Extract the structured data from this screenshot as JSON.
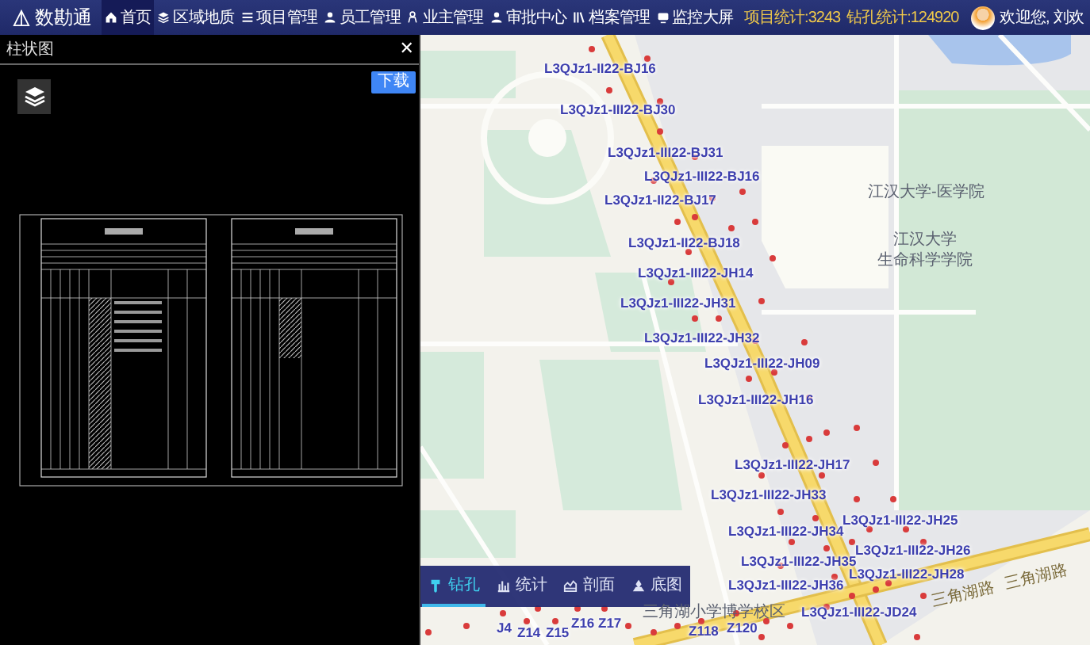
{
  "nav": {
    "logo": "数勘通",
    "items": [
      {
        "label": "首页",
        "kind": "home",
        "selected": true
      },
      {
        "label": "区域地质",
        "kind": "layers",
        "selected": false
      },
      {
        "label": "项目管理",
        "kind": "list",
        "selected": false
      },
      {
        "label": "员工管理",
        "kind": "person",
        "selected": false
      },
      {
        "label": "业主管理",
        "kind": "owner",
        "selected": false
      },
      {
        "label": "审批中心",
        "kind": "person",
        "selected": false
      },
      {
        "label": "档案管理",
        "kind": "books",
        "selected": false
      },
      {
        "label": "监控大屏",
        "kind": "monitor",
        "selected": false
      }
    ],
    "stats": [
      "项目统计:3243",
      "钻孔统计:124920"
    ],
    "greeting": "欢迎您, 刘欢"
  },
  "panel": {
    "title": "柱状图",
    "close": "✕",
    "download": "下载"
  },
  "map": {
    "boreholes": [
      "L3QJz1-II22-BJ16",
      "L3QJz1-III22-BJ30",
      "L3QJz1-III22-BJ31",
      "L3QJz1-III22-BJ16",
      "L3QJz1-II22-BJ17",
      "L3QJz1-II22-BJ18",
      "L3QJz1-III22-JH14",
      "L3QJz1-III22-JH31",
      "L3QJz1-III22-JH32",
      "L3QJz1-III22-JH09",
      "L3QJz1-III22-JH16",
      "L3QJz1-III22-JH17",
      "L3QJz1-III22-JH33",
      "L3QJz1-III22-JH34",
      "L3QJz1-III22-JH25",
      "L3QJz1-III22-JH26",
      "L3QJz1-III22-JH35",
      "L3QJz1-III22-JH28",
      "L3QJz1-III22-JH36",
      "L3QJz1-III22-JD24",
      "J4",
      "Z14",
      "Z15",
      "Z16",
      "Z17",
      "Z118",
      "Z120"
    ],
    "places": [
      "江汉大学-医学院",
      "江汉大学",
      "生命科学学院",
      "三角湖小学博学校区"
    ],
    "roads": [
      "三角湖路",
      "三角湖路"
    ]
  },
  "toolbar": [
    {
      "label": "钻孔",
      "kind": "drill",
      "selected": true
    },
    {
      "label": "统计",
      "kind": "chart",
      "selected": false
    },
    {
      "label": "剖面",
      "kind": "section",
      "selected": false
    },
    {
      "label": "底图",
      "kind": "basemap",
      "selected": false
    }
  ]
}
